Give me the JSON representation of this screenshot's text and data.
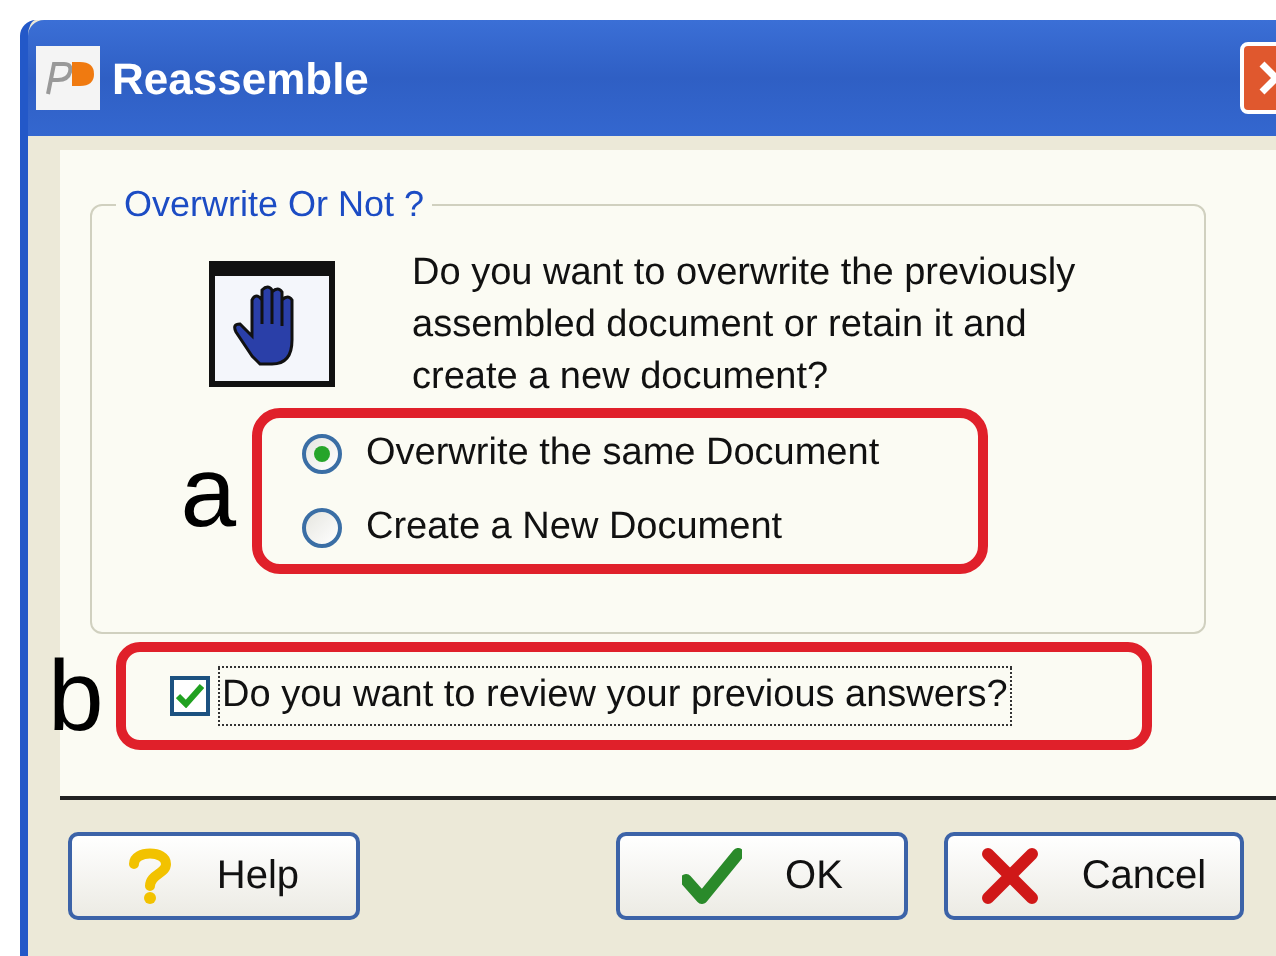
{
  "window": {
    "title": "Reassemble"
  },
  "group": {
    "title": "Overwrite Or Not ?",
    "message": "Do you want to overwrite the previously assembled document or retain it and create a new document?"
  },
  "options": [
    {
      "label": "Overwrite the same Document",
      "selected": true
    },
    {
      "label": "Create a New Document",
      "selected": false
    }
  ],
  "review": {
    "label": "Do you want to review your previous answers?",
    "checked": true
  },
  "annotations": [
    {
      "label": "a"
    },
    {
      "label": "b"
    }
  ],
  "buttons": [
    {
      "kind": "help",
      "label": "Help"
    },
    {
      "kind": "ok",
      "label": "OK"
    },
    {
      "kind": "cancel",
      "label": "Cancel"
    }
  ]
}
